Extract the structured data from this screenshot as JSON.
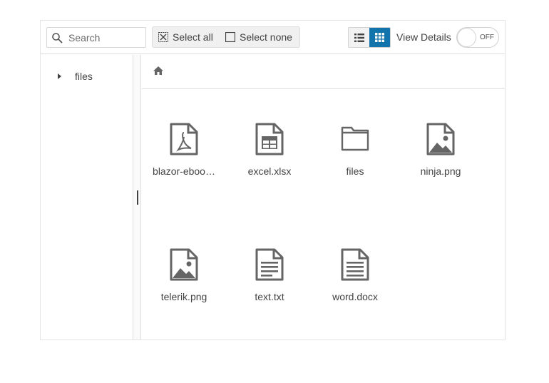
{
  "toolbar": {
    "search_placeholder": "Search",
    "select_all_label": "Select all",
    "select_none_label": "Select none",
    "view_details_label": "View Details",
    "view_details_state": "OFF",
    "active_view": "grid"
  },
  "tree": {
    "items": [
      {
        "label": "files",
        "expanded": false
      }
    ]
  },
  "files": [
    {
      "name": "blazor-ebook.pdf",
      "display": "blazor-eboo…",
      "icon": "pdf-file-icon"
    },
    {
      "name": "excel.xlsx",
      "display": "excel.xlsx",
      "icon": "spreadsheet-file-icon"
    },
    {
      "name": "files",
      "display": "files",
      "icon": "folder-icon"
    },
    {
      "name": "ninja.png",
      "display": "ninja.png",
      "icon": "image-file-icon"
    },
    {
      "name": "telerik.png",
      "display": "telerik.png",
      "icon": "image-file-icon"
    },
    {
      "name": "text.txt",
      "display": "text.txt",
      "icon": "text-file-icon"
    },
    {
      "name": "word.docx",
      "display": "word.docx",
      "icon": "document-file-icon"
    }
  ],
  "colors": {
    "accent": "#1274ac",
    "icon": "#656565",
    "text": "#424242",
    "border": "#dedede"
  }
}
